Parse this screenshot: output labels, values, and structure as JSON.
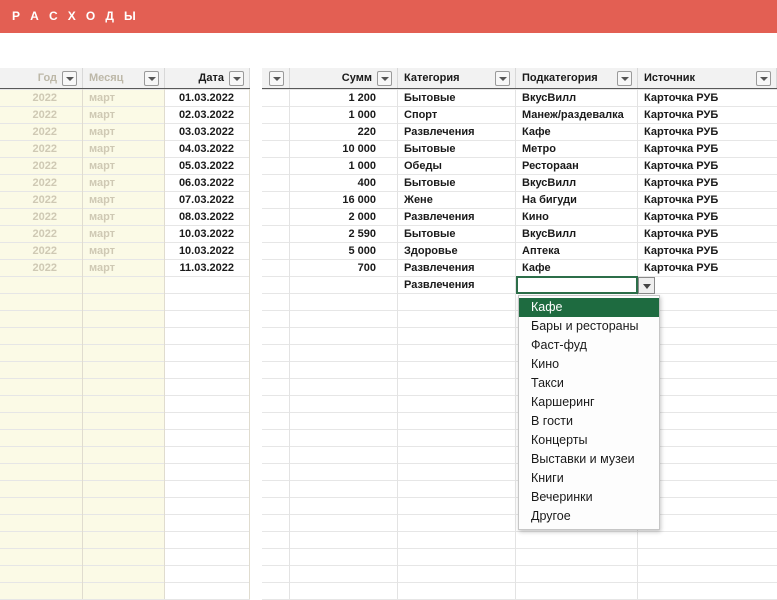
{
  "title": {
    "text": "Р А С Х О Д Ы",
    "bg_color": "#e35f53",
    "text_color": "#ffffff"
  },
  "left_table": {
    "columns": [
      {
        "label": "Год",
        "muted": true,
        "align": "right",
        "filter_icon": "filter-dropdown-icon"
      },
      {
        "label": "Месяц",
        "muted": true,
        "align": "left",
        "filter_icon": "filter-dropdown-icon"
      },
      {
        "label": "Дата",
        "muted": false,
        "align": "right",
        "filter_icon": "filter-dropdown-icon"
      }
    ],
    "rows": [
      {
        "year": "2022",
        "month": "март",
        "date": "01.03.2022"
      },
      {
        "year": "2022",
        "month": "март",
        "date": "02.03.2022"
      },
      {
        "year": "2022",
        "month": "март",
        "date": "03.03.2022"
      },
      {
        "year": "2022",
        "month": "март",
        "date": "04.03.2022"
      },
      {
        "year": "2022",
        "month": "март",
        "date": "05.03.2022"
      },
      {
        "year": "2022",
        "month": "март",
        "date": "06.03.2022"
      },
      {
        "year": "2022",
        "month": "март",
        "date": "07.03.2022"
      },
      {
        "year": "2022",
        "month": "март",
        "date": "08.03.2022"
      },
      {
        "year": "2022",
        "month": "март",
        "date": "10.03.2022"
      },
      {
        "year": "2022",
        "month": "март",
        "date": "10.03.2022"
      },
      {
        "year": "2022",
        "month": "март",
        "date": "11.03.2022"
      }
    ]
  },
  "right_table": {
    "columns": [
      {
        "label": "",
        "align": "left",
        "filter_icon": "filter-dropdown-icon"
      },
      {
        "label": "Сумм",
        "align": "right",
        "filter_icon": "filter-dropdown-icon"
      },
      {
        "label": "Категория",
        "align": "left",
        "filter_icon": "filter-dropdown-icon"
      },
      {
        "label": "Подкатегория",
        "align": "left",
        "filter_icon": "filter-dropdown-icon"
      },
      {
        "label": "Источник",
        "align": "left",
        "filter_icon": "filter-dropdown-icon"
      }
    ],
    "rows": [
      {
        "amount": "1 200",
        "category": "Бытовые",
        "subcategory": "ВкусВилл",
        "source": "Карточка РУБ"
      },
      {
        "amount": "1 000",
        "category": "Спорт",
        "subcategory": "Манеж/раздевалка",
        "source": "Карточка РУБ"
      },
      {
        "amount": "220",
        "category": "Развлечения",
        "subcategory": "Кафе",
        "source": "Карточка РУБ"
      },
      {
        "amount": "10 000",
        "category": "Бытовые",
        "subcategory": "Метро",
        "source": "Карточка РУБ"
      },
      {
        "amount": "1 000",
        "category": "Обеды",
        "subcategory": "Рестораан",
        "source": "Карточка РУБ"
      },
      {
        "amount": "400",
        "category": "Бытовые",
        "subcategory": "ВкусВилл",
        "source": "Карточка РУБ"
      },
      {
        "amount": "16 000",
        "category": "Жене",
        "subcategory": "На бигуди",
        "source": "Карточка РУБ"
      },
      {
        "amount": "2 000",
        "category": "Развлечения",
        "subcategory": "Кино",
        "source": "Карточка РУБ"
      },
      {
        "amount": "2 590",
        "category": "Бытовые",
        "subcategory": "ВкусВилл",
        "source": "Карточка РУБ"
      },
      {
        "amount": "5 000",
        "category": "Здоровье",
        "subcategory": "Аптека",
        "source": "Карточка РУБ"
      },
      {
        "amount": "700",
        "category": "Развлечения",
        "subcategory": "Кафе",
        "source": "Карточка РУБ"
      },
      {
        "amount": "",
        "category": "Развлечения",
        "subcategory": "",
        "source": ""
      }
    ]
  },
  "active_cell": {
    "column": "Подкатегория",
    "row_index": 12,
    "value": "",
    "border_color": "#2c6e49",
    "dropdown_open": true
  },
  "dropdown": {
    "selected": "Кафе",
    "highlight_color": "#1e6b40",
    "items": [
      "Кафе",
      "Бары и рестораны",
      "Фаст-фуд",
      "Кино",
      "Такси",
      "Каршеринг",
      "В гости",
      "Концерты",
      "Выставки и музеи",
      "Книги",
      "Вечеринки",
      "Другое"
    ]
  }
}
